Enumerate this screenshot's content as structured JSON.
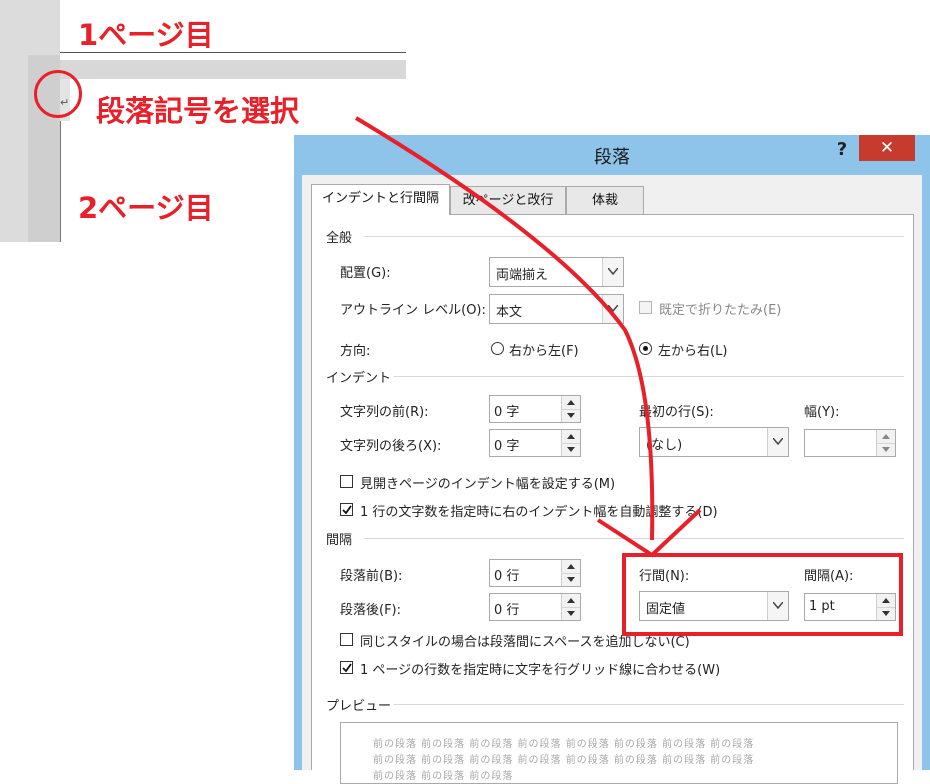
{
  "annotations": {
    "page1": "1ページ目",
    "select_mark": "段落記号を選択",
    "page2": "2ページ目",
    "pilcrow": "↵",
    "accent": "#e8202a"
  },
  "dialog": {
    "title": "段落",
    "help": "?",
    "close": "✕",
    "tabs": [
      "インデントと行間隔",
      "改ページと改行",
      "体裁"
    ],
    "general": {
      "heading": "全般",
      "alignment_label": "配置(G):",
      "alignment_value": "両端揃え",
      "outline_label": "アウトライン レベル(O):",
      "outline_value": "本文",
      "collapsed_label": "既定で折りたたみ(E)",
      "direction_label": "方向:",
      "rtl_label": "右から左(F)",
      "ltr_label": "左から右(L)"
    },
    "indent": {
      "heading": "インデント",
      "before_label": "文字列の前(R):",
      "before_value": "0 字",
      "after_label": "文字列の後ろ(X):",
      "after_value": "0 字",
      "special_label": "最初の行(S):",
      "special_value": "(なし)",
      "by_label": "幅(Y):",
      "by_value": "",
      "mirror_label": "見開きページのインデント幅を設定する(M)",
      "auto_adjust_label": "1 行の文字数を指定時に右のインデント幅を自動調整する(D)"
    },
    "spacing": {
      "heading": "間隔",
      "before_label": "段落前(B):",
      "before_value": "0 行",
      "after_label": "段落後(F):",
      "after_value": "0 行",
      "line_label": "行間(N):",
      "line_value": "固定値",
      "at_label": "間隔(A):",
      "at_value": "1 pt",
      "no_space_label": "同じスタイルの場合は段落間にスペースを追加しない(C)",
      "snap_grid_label": "1 ページの行数を指定時に文字を行グリッド線に合わせる(W)"
    },
    "preview": {
      "heading": "プレビュー",
      "line1": "前の段落 前の段落 前の段落 前の段落 前の段落 前の段落 前の段落 前の段落",
      "line2": "前の段落 前の段落 前の段落 前の段落 前の段落 前の段落 前の段落 前の段落",
      "line3": "前の段落 前の段落 前の段落"
    }
  }
}
